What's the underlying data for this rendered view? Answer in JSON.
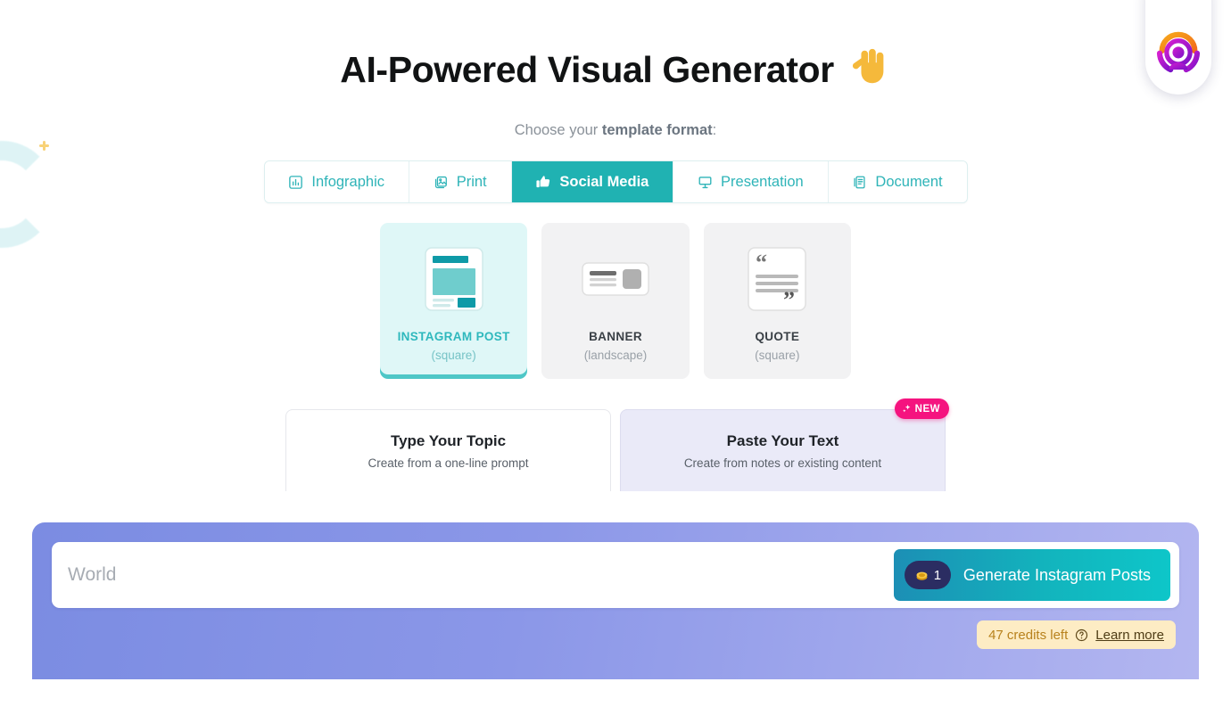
{
  "header": {
    "title": "AI-Powered Visual Generator",
    "hand_icon": "pointing-down-hand",
    "subtitle_prefix": "Choose your ",
    "subtitle_strong": "template format",
    "subtitle_suffix": ":"
  },
  "logo": {
    "name": "app-logo",
    "colors": {
      "orange": "#f79a1e",
      "magenta": "#c21fd0",
      "purple": "#8a14c9"
    }
  },
  "format_tabs": [
    {
      "label": "Infographic",
      "icon": "chart-bar-icon",
      "active": false
    },
    {
      "label": "Print",
      "icon": "photos-icon",
      "active": false
    },
    {
      "label": "Social Media",
      "icon": "thumbs-up-icon",
      "active": true
    },
    {
      "label": "Presentation",
      "icon": "projector-screen-icon",
      "active": false
    },
    {
      "label": "Document",
      "icon": "file-lines-icon",
      "active": false
    }
  ],
  "templates": [
    {
      "name": "INSTAGRAM POST",
      "shape": "(square)",
      "icon": "instagram-post-thumb",
      "selected": true
    },
    {
      "name": "BANNER",
      "shape": "(landscape)",
      "icon": "banner-thumb",
      "selected": false
    },
    {
      "name": "QUOTE",
      "shape": "(square)",
      "icon": "quote-thumb",
      "selected": false
    }
  ],
  "modes": [
    {
      "title": "Type Your Topic",
      "desc": "Create from a one-line prompt",
      "active": true,
      "badge": null
    },
    {
      "title": "Paste Your Text",
      "desc": "Create from notes or existing content",
      "active": false,
      "badge": "NEW"
    }
  ],
  "generator": {
    "input_placeholder": "World",
    "input_value": "",
    "coin_icon": "coin-icon",
    "coin_cost": "1",
    "button_label": "Generate Instagram Posts",
    "credits_text": "47 credits left",
    "help_icon": "question-circle-icon",
    "learn_more": "Learn more"
  },
  "colors": {
    "teal": "#20b2b2",
    "pink": "#f5137f",
    "panel_from": "#7b8ce2",
    "panel_to": "#b3b6f0",
    "credit_bg": "#fdecc4"
  }
}
